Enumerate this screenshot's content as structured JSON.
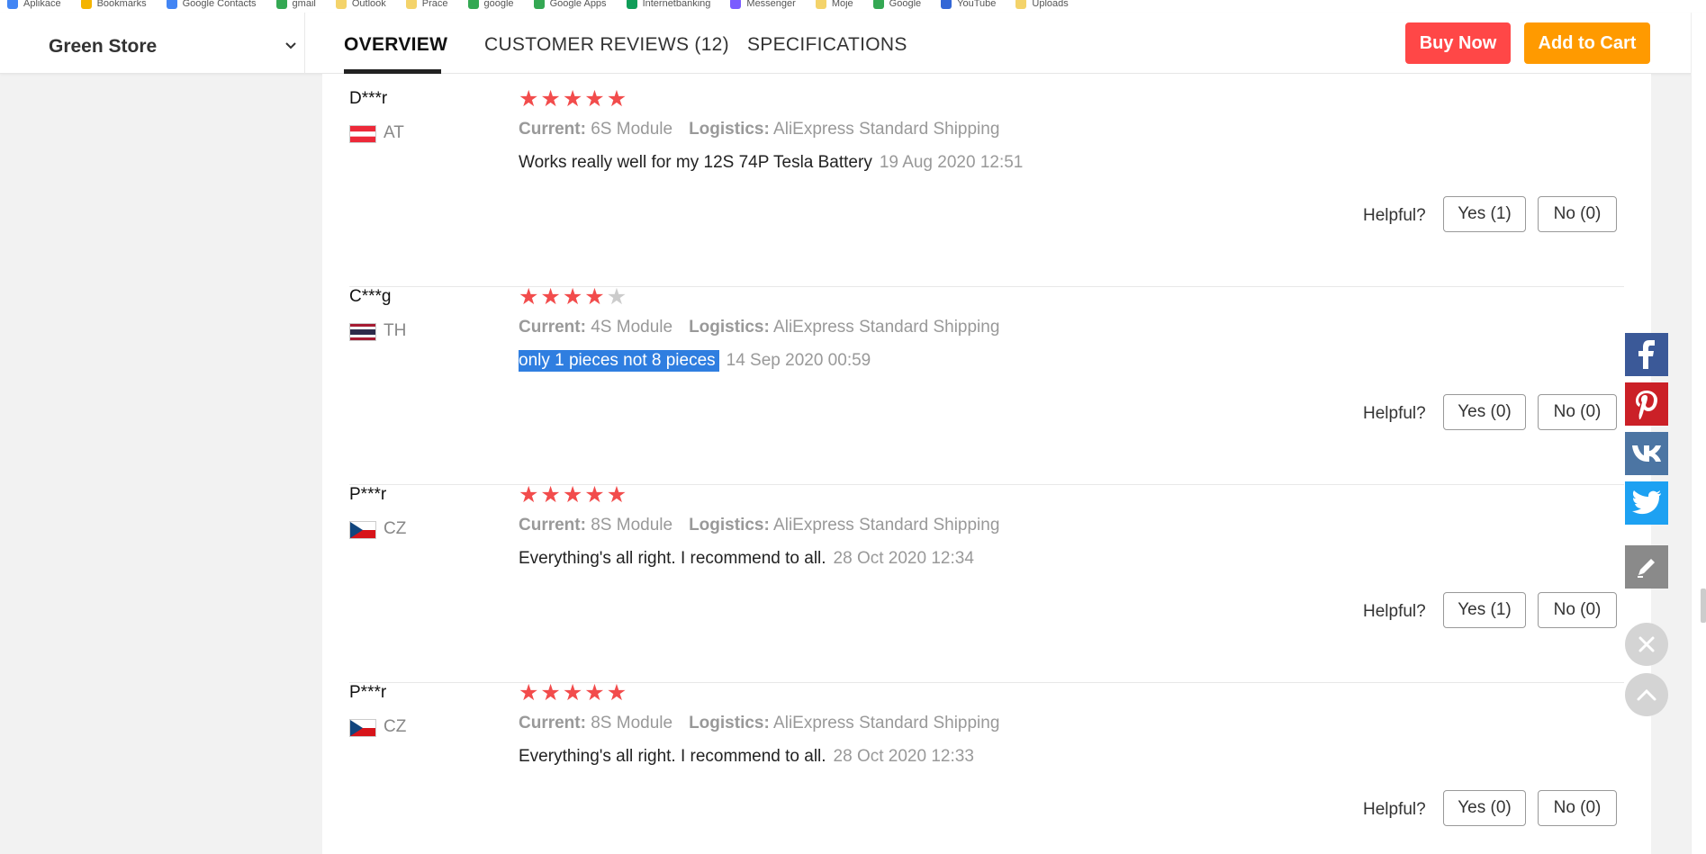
{
  "bookmarks": [
    "Aplikace",
    "Bookmarks",
    "Google Contacts",
    "gmail",
    "Outlook",
    "Prace",
    "google",
    "Google Apps",
    "Internetbanking",
    "Messenger",
    "Moje",
    "Google",
    "YouTube",
    "Uploads"
  ],
  "header": {
    "store_name": "Green Store",
    "tabs": [
      {
        "label": "OVERVIEW",
        "active": true
      },
      {
        "label": "CUSTOMER REVIEWS (12)",
        "active": false
      },
      {
        "label": "SPECIFICATIONS",
        "active": false
      }
    ],
    "buy_now_label": "Buy Now",
    "add_to_cart_label": "Add to Cart"
  },
  "reviews": [
    {
      "name": "D***r",
      "country": "AT",
      "stars": 5,
      "current_label": "Current:",
      "current": "6S Module",
      "logistics_label": "Logistics:",
      "logistics": "AliExpress Standard Shipping",
      "text": "Works really well for my 12S 74P Tesla Battery",
      "date": "19 Aug 2020 12:51",
      "helpful_label": "Helpful?",
      "yes": "Yes (1)",
      "no": "No (0)",
      "selected": false
    },
    {
      "name": "C***g",
      "country": "TH",
      "stars": 4,
      "current_label": "Current:",
      "current": "4S Module",
      "logistics_label": "Logistics:",
      "logistics": "AliExpress Standard Shipping",
      "text": "only 1 pieces not 8 pieces",
      "date": "14 Sep 2020 00:59",
      "helpful_label": "Helpful?",
      "yes": "Yes (0)",
      "no": "No (0)",
      "selected": true
    },
    {
      "name": "P***r",
      "country": "CZ",
      "stars": 5,
      "current_label": "Current:",
      "current": "8S Module",
      "logistics_label": "Logistics:",
      "logistics": "AliExpress Standard Shipping",
      "text": "Everything's all right. I recommend to all.",
      "date": "28 Oct 2020 12:34",
      "helpful_label": "Helpful?",
      "yes": "Yes (1)",
      "no": "No (0)",
      "selected": false
    },
    {
      "name": "P***r",
      "country": "CZ",
      "stars": 5,
      "current_label": "Current:",
      "current": "8S Module",
      "logistics_label": "Logistics:",
      "logistics": "AliExpress Standard Shipping",
      "text": "Everything's all right. I recommend to all.",
      "date": "28 Oct 2020 12:33",
      "helpful_label": "Helpful?",
      "yes": "Yes (0)",
      "no": "No (0)",
      "selected": false
    }
  ],
  "social": [
    {
      "name": "facebook-icon",
      "color": "#3b5998"
    },
    {
      "name": "pinterest-icon",
      "color": "#cb2027"
    },
    {
      "name": "vk-icon",
      "color": "#4c75a3"
    },
    {
      "name": "twitter-icon",
      "color": "#1da1f2"
    },
    {
      "name": "edit-icon",
      "color": "#8a8a8a"
    }
  ],
  "colors": {
    "buy_now": "#ff4747",
    "add_to_cart": "#ff9a00",
    "star": "#f24c4c",
    "selection": "#2f7ee0"
  }
}
